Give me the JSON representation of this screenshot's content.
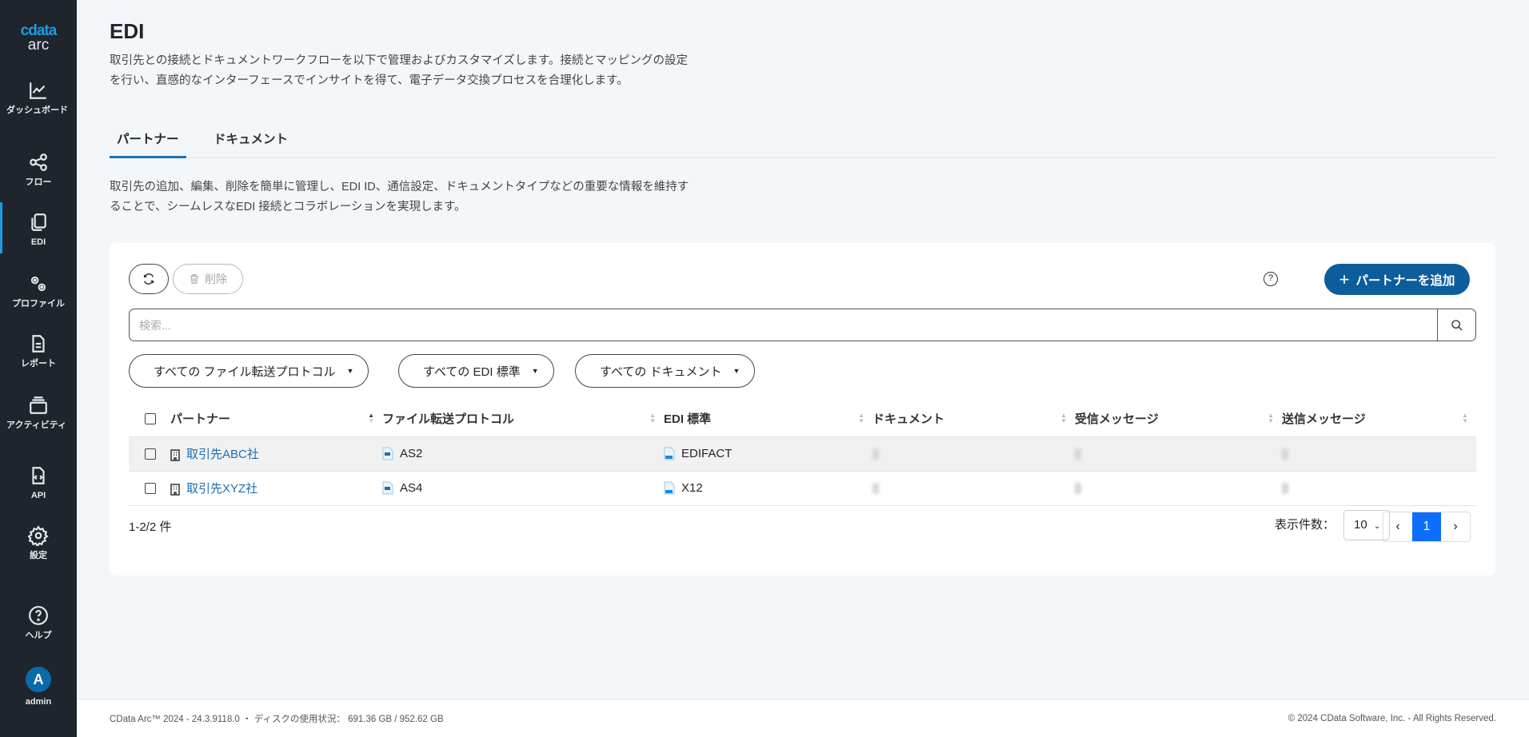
{
  "sidebar": {
    "logo_brand": "cdata",
    "logo_product": "arc",
    "items": [
      {
        "label": "ダッシュボード",
        "icon": "chart-line-icon"
      },
      {
        "label": "フロー",
        "icon": "share-nodes-icon"
      },
      {
        "label": "EDI",
        "icon": "copy-icon",
        "active": true
      },
      {
        "label": "プロファイル",
        "icon": "gears-icon"
      },
      {
        "label": "レポート",
        "icon": "file-text-icon"
      },
      {
        "label": "アクティビティ",
        "icon": "layers-icon"
      },
      {
        "label": "API",
        "icon": "file-code-icon"
      },
      {
        "label": "設定",
        "icon": "gear-icon"
      },
      {
        "label": "ヘルプ",
        "icon": "help-icon"
      }
    ],
    "user": {
      "initial": "A",
      "name": "admin"
    }
  },
  "page": {
    "title": "EDI",
    "description": [
      "取引先との接続とドキュメントワークフローを以下で管理およびカスタマイズします。接続とマッピングの設定",
      "を行い、直感的なインターフェースでインサイトを得て、電子データ交換プロセスを合理化します。"
    ],
    "tabs": [
      {
        "label": "パートナー",
        "active": true
      },
      {
        "label": "ドキュメント"
      }
    ],
    "tab_description": [
      "取引先の追加、編集、削除を簡単に管理し、EDI ID、通信設定、ドキュメントタイプなどの重要な情報を維持す",
      "ることで、シームレスなEDI 接続とコラボレーションを実現します。"
    ]
  },
  "toolbar": {
    "delete_label": "削除",
    "add_label": "パートナーを追加",
    "help": "?"
  },
  "search": {
    "placeholder": "検索...",
    "value": ""
  },
  "filters": [
    "すべての ファイル転送プロトコル",
    "すべての EDI 標準",
    "すべての ドキュメント"
  ],
  "table": {
    "headers": [
      "パートナー",
      "ファイル転送プロトコル",
      "EDI 標準",
      "ドキュメント",
      "受信メッセージ",
      "送信メッセージ"
    ],
    "rows": [
      {
        "partner": "取引先ABC社",
        "protocol": "AS2",
        "standard": "EDIFACT"
      },
      {
        "partner": "取引先XYZ社",
        "protocol": "AS4",
        "standard": "X12"
      }
    ]
  },
  "pagination": {
    "count": "1-2/2 件",
    "per_page_label": "表示件数：",
    "per_page": "10",
    "current_page": "1"
  },
  "footer": {
    "left": "CData Arc™ 2024 - 24.3.9118.0 ・ ディスクの使用状況： 691.36 GB / 952.62 GB",
    "right": "© 2024 CData Software, Inc. - All Rights Reserved."
  },
  "colors": {
    "sidebar": "#1e252c",
    "accent": "#1e9be0",
    "primary_button": "#0d5d9c",
    "page_active": "#0d6efd"
  }
}
